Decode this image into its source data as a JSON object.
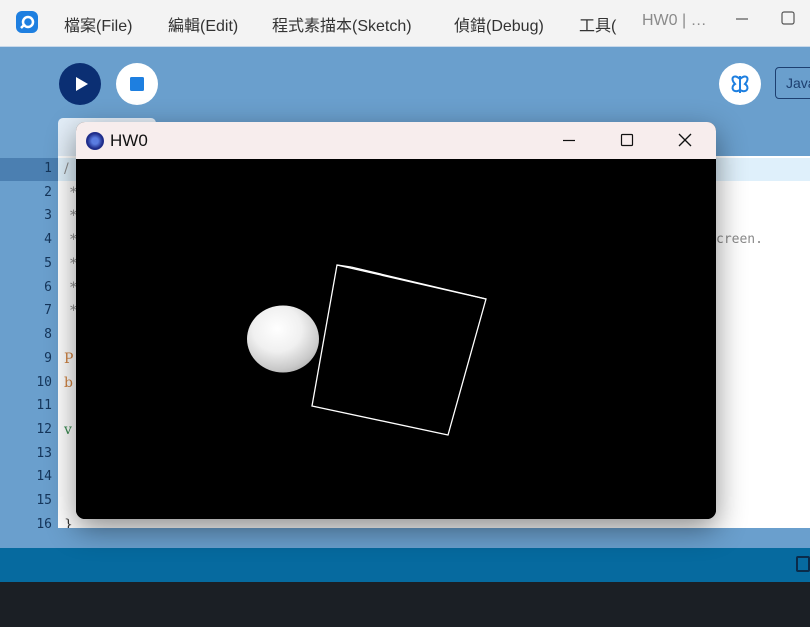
{
  "menubar": {
    "items": [
      "檔案(File)",
      "編輯(Edit)",
      "程式素描本(Sketch)",
      "偵錯(Debug)",
      "工具("
    ],
    "title": "HW0 | …"
  },
  "toolbar": {
    "run_icon": "play-icon",
    "stop_icon": "stop-icon",
    "debug_icon": "butterfly-icon",
    "mode_label": "Java"
  },
  "editor": {
    "line_numbers": [
      "1",
      "2",
      "3",
      "4",
      "5",
      "6",
      "7",
      "8",
      "9",
      "10",
      "11",
      "12",
      "13",
      "14",
      "15",
      "16"
    ],
    "visible_code": {
      "line1": "/",
      "line2": "*",
      "line3": "*",
      "line4": "*",
      "line4_right": "creen.",
      "line5": "*",
      "line6": "*",
      "line7": "*",
      "line9": "P",
      "line10": "b",
      "line12": "v",
      "line16": "}"
    }
  },
  "sketch_window": {
    "title": "HW0",
    "min_icon": "minimize-icon",
    "max_icon": "maximize-icon",
    "close_icon": "close-icon"
  },
  "colors": {
    "toolbar": "#6a9fcd",
    "run_button": "#0b2f73",
    "console_bar": "#066a9f",
    "console": "#1b1f25",
    "canvas": "#000000"
  }
}
